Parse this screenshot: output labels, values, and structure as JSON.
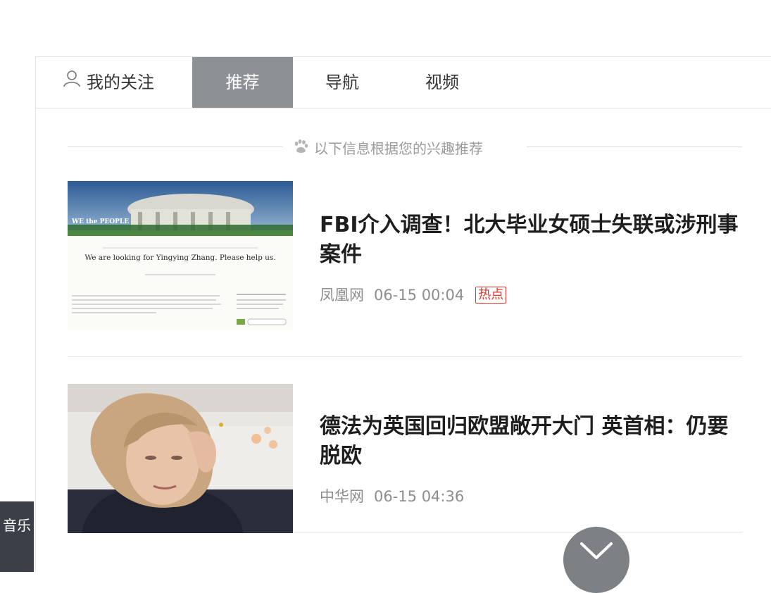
{
  "tabs": {
    "follow": "我的关注",
    "recommend": "推荐",
    "navigation": "导航",
    "video": "视频"
  },
  "feed_hint": "以下信息根据您的兴趣推荐",
  "news": [
    {
      "title": "FBI介入调查！北大毕业女硕士失联或涉刑事案件",
      "source": "凤凰网",
      "time": "06-15 00:04",
      "badge": "热点",
      "thumb": {
        "banner": "WE the PEOPLE",
        "headline": "We are looking for Yingying Zhang. Please help us."
      }
    },
    {
      "title": "德法为英国回归欧盟敞开大门 英首相：仍要脱欧",
      "source": "中华网",
      "time": "06-15 04:36"
    }
  ],
  "sidebar": {
    "music_label": "音乐"
  },
  "colors": {
    "active_tab": "#8c9196",
    "hot_badge": "#e8342a",
    "music_tab": "#3b4047"
  },
  "icons": {
    "follow": "user-icon",
    "hint": "paw-icon",
    "more": "chevron-down-icon"
  }
}
